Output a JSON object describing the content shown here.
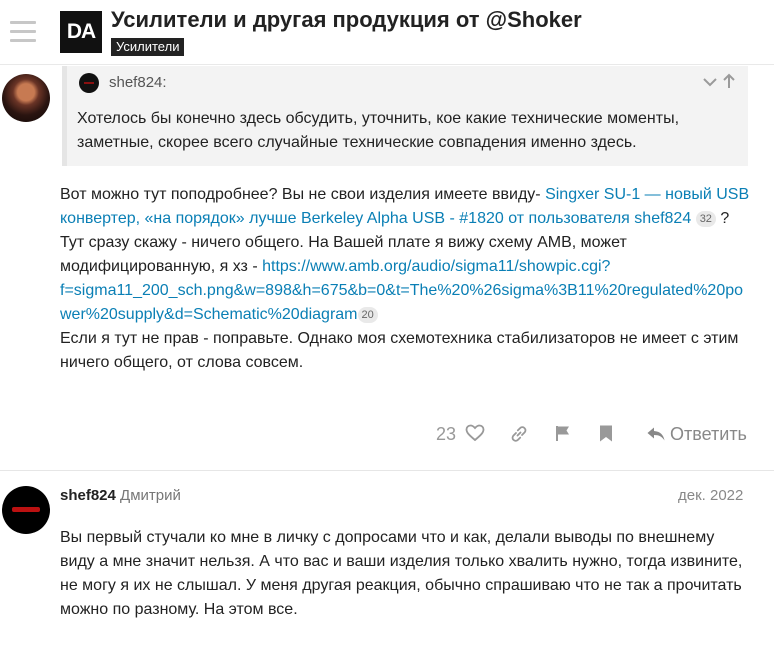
{
  "header": {
    "logo_text": "DA",
    "title": "Усилители и другая продукция от @Shoker",
    "category": "Усилители"
  },
  "post1": {
    "quote": {
      "author": "shef824:",
      "line1": "Хотелось бы конечно здесь обсудить, уточнить, кое какие технические моменты,",
      "line2": "заметные, скорее всего случайные технические совпадения именно здесь."
    },
    "body": {
      "line1_text": "Вот можно тут поподробнее? Вы не свои изделия имеете ввиду- ",
      "line1_link": "Singxer SU-1 — новый USB",
      "line2_link": "конвертер, «на порядок» лучше Berkeley Alpha USB - #1820 от пользователя shef824",
      "line2_badge": "32",
      "line2_after": " ?",
      "line3": "Тут сразу скажу - ничего общего. На Вашей плате я вижу схему АМВ, может",
      "line4_text": "модифицированную, я хз - ",
      "line4_link": "https://www.amb.org/audio/sigma11/showpic.cgi?",
      "line5_link": "f=sigma11_200_sch.png&w=898&h=675&b=0&t=The%20%26sigma%3B11%20regulated%20po",
      "line6_link": "wer%20supply&d=Schematic%20diagram",
      "line6_badge": "20",
      "line7": "Если я тут не прав - поправьте. Однако моя схемотехника стабилизаторов не имеет с этим",
      "line8": "ничего общего, от слова совсем."
    },
    "actions": {
      "like_count": "23",
      "reply_label": "Ответить"
    }
  },
  "post2": {
    "username": "shef824",
    "fullname": "Дмитрий",
    "date": "дек. 2022",
    "line1": "Вы первый стучали ко мне в личку с допросами что и как, делали выводы по внешнему",
    "line2": "виду а мне значит нельзя. А что вас и ваши изделия только хвалить нужно, тогда извините,",
    "line3": "не могу я их не слышал. У меня другая реакция, обычно спрашиваю что не так а прочитать",
    "line4": "можно по разному. На этом все."
  },
  "colors": {
    "link": "#0a7fb5",
    "badge_bg": "#222222",
    "quote_bg": "#f3f3f3"
  }
}
